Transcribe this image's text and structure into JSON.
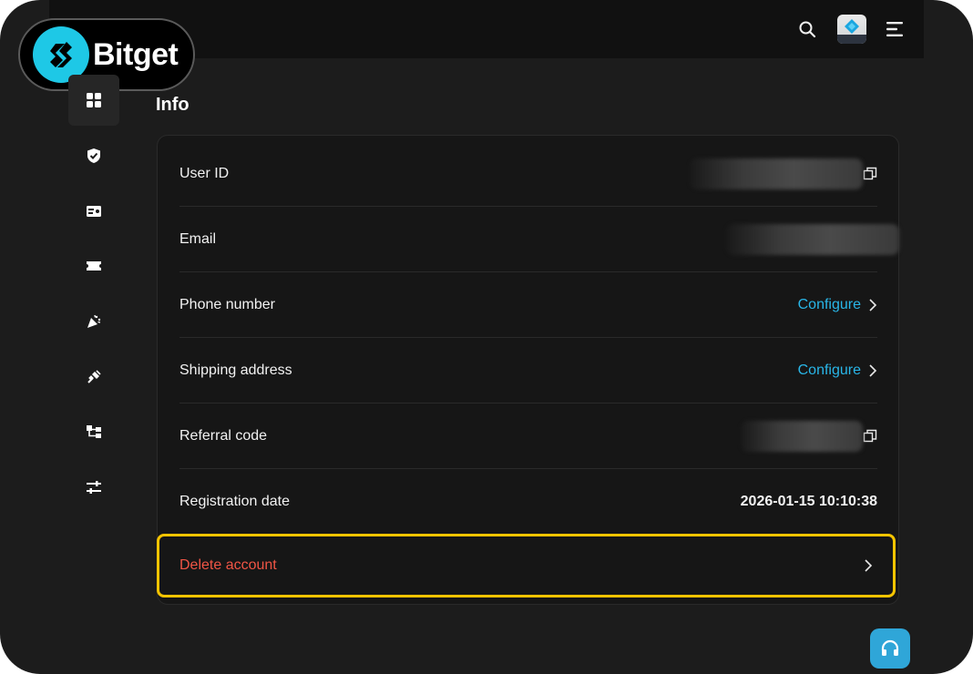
{
  "brand": {
    "name": "Bitget"
  },
  "header": {
    "icons": [
      "search-icon",
      "avatar",
      "menu-icon"
    ]
  },
  "sidebar": {
    "items": [
      {
        "icon": "dashboard-icon",
        "active": true
      },
      {
        "icon": "security-shield-icon",
        "active": false
      },
      {
        "icon": "identity-card-icon",
        "active": false
      },
      {
        "icon": "coupon-ticket-icon",
        "active": false
      },
      {
        "icon": "celebration-icon",
        "active": false
      },
      {
        "icon": "api-plug-icon",
        "active": false
      },
      {
        "icon": "sub-account-icon",
        "active": false
      },
      {
        "icon": "preferences-sliders-icon",
        "active": false
      }
    ]
  },
  "info": {
    "title": "Info",
    "rows": {
      "user_id": {
        "label": "User ID"
      },
      "email": {
        "label": "Email"
      },
      "phone": {
        "label": "Phone number",
        "action": "Configure"
      },
      "shipping": {
        "label": "Shipping address",
        "action": "Configure"
      },
      "referral": {
        "label": "Referral code"
      },
      "registration": {
        "label": "Registration date",
        "value": "2026-01-15 10:10:38"
      }
    },
    "delete_account": {
      "label": "Delete account"
    }
  },
  "colors": {
    "accent": "#29b6e8",
    "danger": "#f05545",
    "highlight": "#f5c400",
    "background": "#1c1c1c"
  }
}
